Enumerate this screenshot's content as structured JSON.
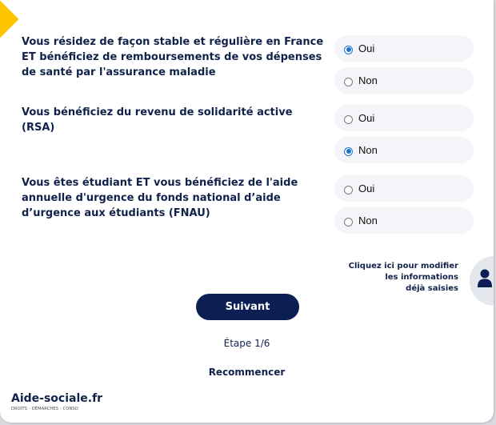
{
  "questions": [
    {
      "text": "Vous résidez de façon stable et régulière en France ET bénéficiez de remboursements de vos dépenses de santé par l'assurance maladie",
      "options": [
        {
          "label": "Oui",
          "selected": true
        },
        {
          "label": "Non",
          "selected": false
        }
      ]
    },
    {
      "text": "Vous bénéficiez du revenu de solidarité active (RSA)",
      "options": [
        {
          "label": "Oui",
          "selected": false
        },
        {
          "label": "Non",
          "selected": true
        }
      ]
    },
    {
      "text": "Vous êtes étudiant ET vous bénéficiez de l'aide annuelle d'urgence du fonds national d’aide d’urgence aux étudiants (FNAU)",
      "options": [
        {
          "label": "Oui",
          "selected": false
        },
        {
          "label": "Non",
          "selected": false
        }
      ]
    }
  ],
  "modify": {
    "line1": "Cliquez ici pour modifier",
    "line2": "les informations",
    "line3": "déjà saisies",
    "icon": "user-icon"
  },
  "actions": {
    "next_label": "Suivant",
    "step_text": "Étape 1/6",
    "restart_label": "Recommencer"
  },
  "brand": {
    "name": "Aide-sociale.fr",
    "tagline": "DROITS - DÉMARCHES - CONSO",
    "accent_color": "#ffc400",
    "primary_color": "#0c1f55",
    "radio_color": "#1e73d2"
  }
}
